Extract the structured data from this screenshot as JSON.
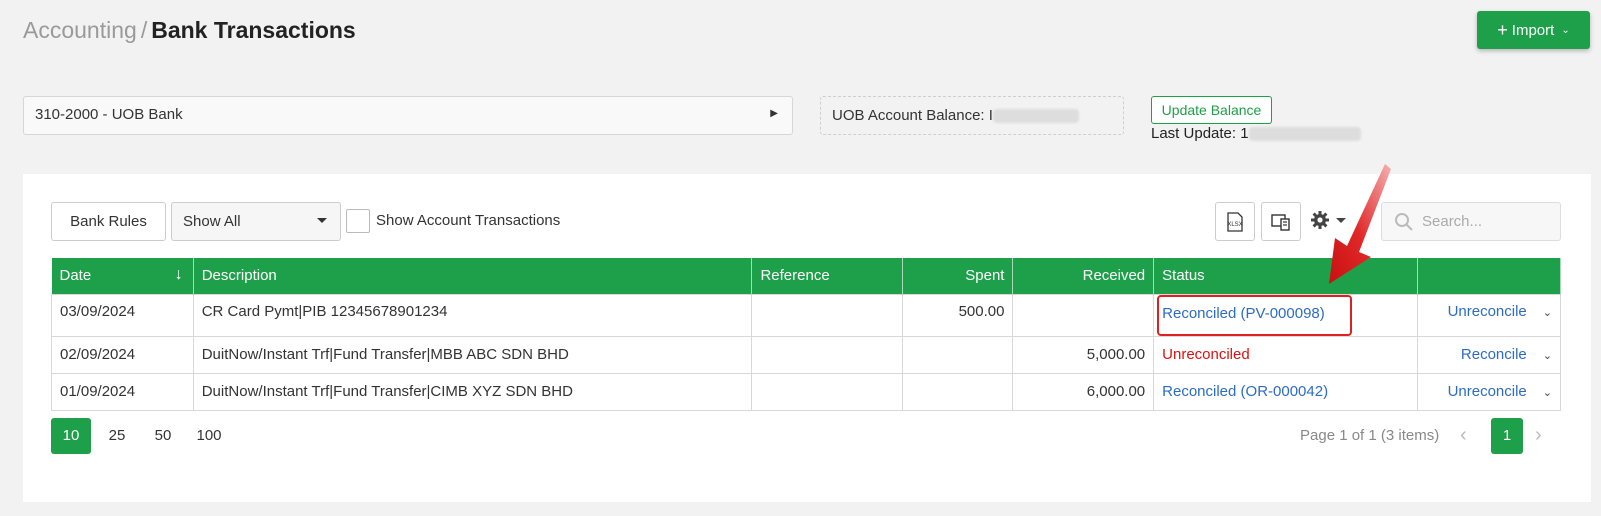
{
  "breadcrumb": {
    "parent": "Accounting",
    "separator": "/",
    "current": "Bank Transactions"
  },
  "header": {
    "import_label": "Import"
  },
  "bank_account": {
    "selected": "310-2000 - UOB Bank"
  },
  "balance": {
    "label": "UOB Account Balance: I"
  },
  "update": {
    "button_label": "Update Balance",
    "last_update_label": "Last Update: 1"
  },
  "toolbar": {
    "bank_rules_label": "Bank Rules",
    "filter_selected": "Show All",
    "show_account_tx_label": "Show Account Transactions",
    "search_placeholder": "Search..."
  },
  "table": {
    "columns": [
      "Date",
      "Description",
      "Reference",
      "Spent",
      "Received",
      "Status",
      ""
    ],
    "rows": [
      {
        "date": "03/09/2024",
        "description": "CR Card Pymt|PIB 12345678901234",
        "reference": "",
        "spent": "500.00",
        "received": "",
        "status": "Reconciled (PV-000098)",
        "action": "Unreconcile"
      },
      {
        "date": "02/09/2024",
        "description": "DuitNow/Instant Trf|Fund Transfer|MBB ABC SDN BHD",
        "reference": "",
        "spent": "",
        "received": "5,000.00",
        "status": "Unreconciled",
        "action": "Reconcile"
      },
      {
        "date": "01/09/2024",
        "description": "DuitNow/Instant Trf|Fund Transfer|CIMB XYZ SDN BHD",
        "reference": "",
        "spent": "",
        "received": "6,000.00",
        "status": "Reconciled (OR-000042)",
        "action": "Unreconcile"
      }
    ]
  },
  "pager": {
    "sizes": [
      "10",
      "25",
      "50",
      "100"
    ],
    "active_size": "10",
    "info": "Page 1 of 1 (3 items)",
    "current_page": "1"
  },
  "colors": {
    "accent": "#1ea04a",
    "link": "#2d6cc3",
    "danger": "#dd1111",
    "annotation": "#e02020"
  }
}
